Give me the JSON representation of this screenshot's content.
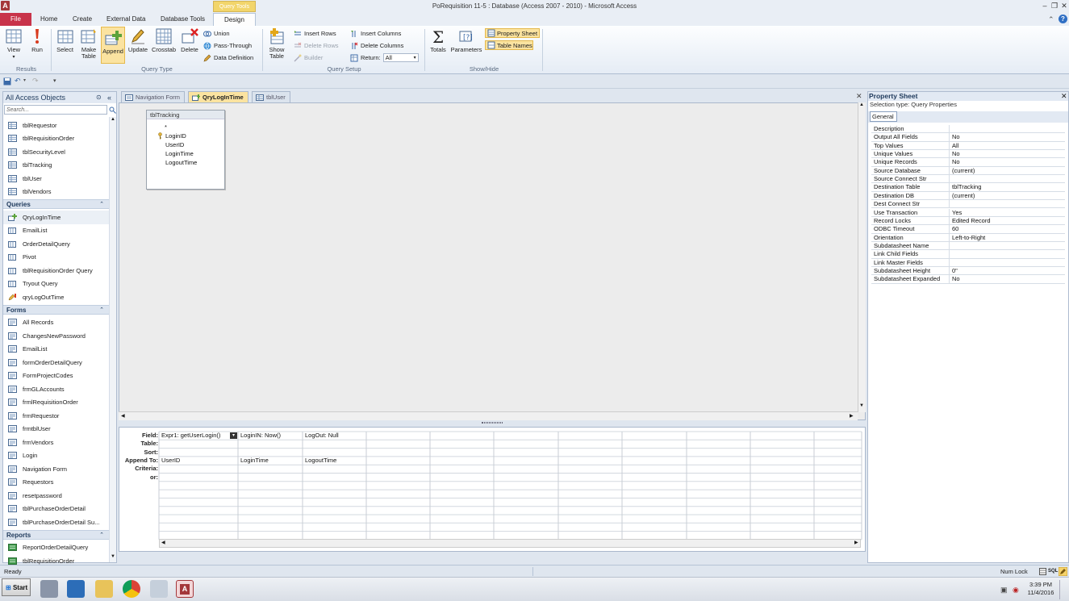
{
  "window": {
    "title": "PoRequisition 11-5 : Database (Access 2007 - 2010) - Microsoft Access",
    "app_icon": "A"
  },
  "tabs": {
    "file": "File",
    "home": "Home",
    "create": "Create",
    "external": "External Data",
    "dbtools": "Database Tools",
    "context_label": "Query Tools",
    "design": "Design"
  },
  "ribbon": {
    "view": "View",
    "run": "Run",
    "group_results": "Results",
    "select": "Select",
    "make_table_1": "Make",
    "make_table_2": "Table",
    "append": "Append",
    "update": "Update",
    "crosstab": "Crosstab",
    "delete": "Delete",
    "union": "Union",
    "passthrough": "Pass-Through",
    "data_definition": "Data Definition",
    "group_query_type": "Query Type",
    "show_table_1": "Show",
    "show_table_2": "Table",
    "insert_rows": "Insert Rows",
    "delete_rows": "Delete Rows",
    "builder": "Builder",
    "insert_columns": "Insert Columns",
    "delete_columns": "Delete Columns",
    "return_label": "Return:",
    "return_value": "All",
    "group_query_setup": "Query Setup",
    "totals": "Totals",
    "parameters": "Parameters",
    "property_sheet": "Property Sheet",
    "table_names": "Table Names",
    "group_show_hide": "Show/Hide"
  },
  "nav": {
    "title": "All Access Objects",
    "search_placeholder": "Search...",
    "tables": [
      "tblRequestor",
      "tblRequisitionOrder",
      "tblSecurityLevel",
      "tblTracking",
      "tblUser",
      "tblVendors"
    ],
    "queries_header": "Queries",
    "queries": [
      "QryLogInTime",
      "EmailList",
      "OrderDetailQuery",
      "Pivot",
      "tblRequisitionOrder Query",
      "Tryout Query",
      "qryLogOutTime"
    ],
    "forms_header": "Forms",
    "forms": [
      "All Records",
      "ChangesNewPassword",
      "EmailList",
      "formOrderDetailQuery",
      "FormProjectCodes",
      "frmGLAccounts",
      "frmlRequisitionOrder",
      "frmRequestor",
      "frmtblUser",
      "frmVendors",
      "Login",
      "Navigation Form",
      "Requestors",
      "resetpassword",
      "tblPurchaseOrderDetail",
      "tblPurchaseOrderDetail Su..."
    ],
    "reports_header": "Reports",
    "reports": [
      "ReportOrderDetailQuery",
      "tblRequisitionOrder"
    ]
  },
  "doc_tabs": [
    "Navigation Form",
    "QryLogInTime",
    "tblUser"
  ],
  "field_list": {
    "title": "tblTracking",
    "fields": [
      "*",
      "LoginID",
      "UserID",
      "LoginTime",
      "LogoutTime"
    ]
  },
  "grid": {
    "row_labels": [
      "Field:",
      "Table:",
      "Sort:",
      "Append To:",
      "Criteria:",
      "or:"
    ],
    "columns": [
      {
        "field": "Expr1: getUserLogin()",
        "append_to": "UserID"
      },
      {
        "field": "LoginIN: Now()",
        "append_to": "LoginTime"
      },
      {
        "field": "LogOut: Null",
        "append_to": "LogoutTime"
      }
    ]
  },
  "property_sheet": {
    "title": "Property Sheet",
    "selection_type": "Selection type:  Query Properties",
    "tab": "General",
    "rows": [
      {
        "name": "Description",
        "value": ""
      },
      {
        "name": "Output All Fields",
        "value": "No"
      },
      {
        "name": "Top Values",
        "value": "All"
      },
      {
        "name": "Unique Values",
        "value": "No"
      },
      {
        "name": "Unique Records",
        "value": "No"
      },
      {
        "name": "Source Database",
        "value": "(current)"
      },
      {
        "name": "Source Connect Str",
        "value": ""
      },
      {
        "name": "Destination Table",
        "value": "tblTracking"
      },
      {
        "name": "Destination DB",
        "value": "(current)"
      },
      {
        "name": "Dest Connect Str",
        "value": ""
      },
      {
        "name": "Use Transaction",
        "value": "Yes"
      },
      {
        "name": "Record Locks",
        "value": "Edited Record"
      },
      {
        "name": "ODBC Timeout",
        "value": "60"
      },
      {
        "name": "Orientation",
        "value": "Left-to-Right"
      },
      {
        "name": "Subdatasheet Name",
        "value": ""
      },
      {
        "name": "Link Child Fields",
        "value": ""
      },
      {
        "name": "Link Master Fields",
        "value": ""
      },
      {
        "name": "Subdatasheet Height",
        "value": "0\""
      },
      {
        "name": "Subdatasheet Expanded",
        "value": "No"
      }
    ]
  },
  "status": {
    "left": "Ready",
    "numlock": "Num Lock",
    "sql": "SQL"
  },
  "taskbar": {
    "start": "Start",
    "time": "3:39 PM",
    "date": "11/4/2016"
  },
  "colors": {
    "file_tab": "#c8334a",
    "context": "#f2d56b",
    "active_tab": "#fbe3a0"
  }
}
